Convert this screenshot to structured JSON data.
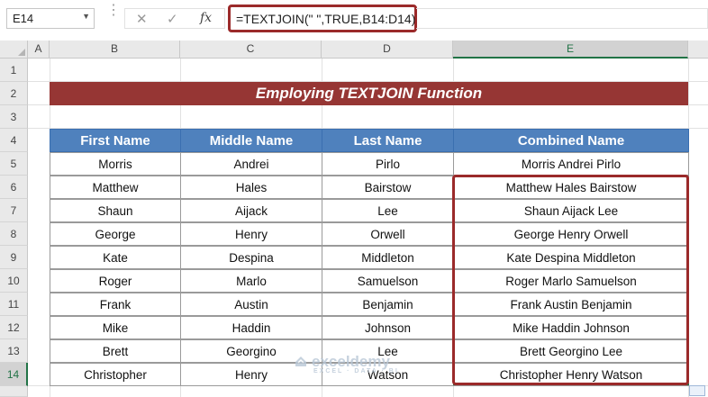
{
  "formula_bar": {
    "name_box": "E14",
    "formula": "=TEXTJOIN(\" \",TRUE,B14:D14)",
    "icons": [
      "cancel-icon",
      "enter-icon",
      "function-icon"
    ]
  },
  "columns": [
    "A",
    "B",
    "C",
    "D",
    "E"
  ],
  "rows": [
    "1",
    "2",
    "3",
    "4",
    "5",
    "6",
    "7",
    "8",
    "9",
    "10",
    "11",
    "12",
    "13",
    "14"
  ],
  "title": "Employing TEXTJOIN Function",
  "table": {
    "headers": [
      "First Name",
      "Middle Name",
      "Last Name",
      "Combined Name"
    ],
    "rows": [
      [
        "Morris",
        "Andrei",
        "Pirlo",
        "Morris Andrei Pirlo"
      ],
      [
        "Matthew",
        "Hales",
        "Bairstow",
        "Matthew Hales Bairstow"
      ],
      [
        "Shaun",
        "Aijack",
        "Lee",
        "Shaun Aijack Lee"
      ],
      [
        "George",
        "Henry",
        "Orwell",
        "George Henry Orwell"
      ],
      [
        "Kate",
        "Despina",
        "Middleton",
        "Kate Despina Middleton"
      ],
      [
        "Roger",
        "Marlo",
        "Samuelson",
        "Roger Marlo Samuelson"
      ],
      [
        "Frank",
        "Austin",
        "Benjamin",
        "Frank Austin Benjamin"
      ],
      [
        "Mike",
        "Haddin",
        "Johnson",
        "Mike Haddin Johnson"
      ],
      [
        "Brett",
        "Georgino",
        "Lee",
        "Brett Georgino Lee"
      ],
      [
        "Christopher",
        "Henry",
        "Watson",
        "Christopher Henry Watson"
      ]
    ]
  },
  "watermark": {
    "name": "exceldemy",
    "tagline": "EXCEL · DATA · BI"
  },
  "colors": {
    "title_bg": "#963634",
    "header_bg": "#4f81bd",
    "highlight": "#9b2a2a",
    "excel_green": "#217346"
  }
}
